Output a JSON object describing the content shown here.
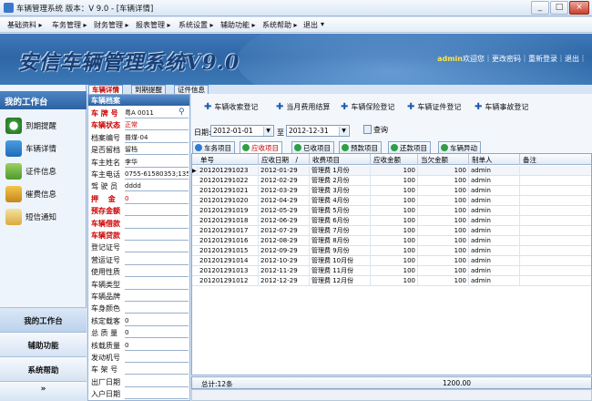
{
  "window": {
    "title": "车辆管理系统  版本：V 9.0 - [车辆详情]",
    "buttons": [
      "_",
      "□",
      "×"
    ]
  },
  "menu": [
    "基础资料 ▸",
    "车务管理 ▸",
    "财务管理 ▸",
    "报表管理 ▸",
    "系统设置 ▸",
    "辅助功能 ▸",
    "系统帮助 ▸",
    "退出",
    "▾"
  ],
  "banner": {
    "title": "安信车辆管理系统V9.0",
    "username": "admin",
    "welcome": "欢迎您",
    "links": "｜更改密码｜重新登录｜退出｜"
  },
  "sidebar": {
    "header": "我的工作台",
    "items": [
      {
        "label": "到期提醒",
        "icon": "clock-icon"
      },
      {
        "label": "车辆详情",
        "icon": "car-icon"
      },
      {
        "label": "证件信息",
        "icon": "certificate-icon"
      },
      {
        "label": "催费信息",
        "icon": "money-icon"
      },
      {
        "label": "短信通知",
        "icon": "envelope-icon"
      }
    ],
    "footer": [
      "我的工作台",
      "辅助功能",
      "系统帮助"
    ]
  },
  "top_tabs": [
    "车辆详情",
    "到期提醒",
    "证件信息"
  ],
  "archive": {
    "header": "车辆档案",
    "fields": [
      {
        "label": "车 牌 号",
        "value": "粤A 0011",
        "red": true
      },
      {
        "label": "车辆状态",
        "value": "正常",
        "red": true,
        "valred": true
      },
      {
        "label": "档案编号",
        "value": "普煤-04"
      },
      {
        "label": "是否留档",
        "value": "留档"
      },
      {
        "label": "车主姓名",
        "value": "李华"
      },
      {
        "label": "车主电话",
        "value": "0755-61580353;135"
      },
      {
        "label": "驾 驶 员",
        "value": "dddd"
      },
      {
        "label": "押　 金",
        "value": "0",
        "red": true,
        "valred": true
      },
      {
        "label": "预存金额",
        "value": "",
        "red": true
      },
      {
        "label": "车辆借款",
        "value": "",
        "red": true
      },
      {
        "label": "车辆贷款",
        "value": "",
        "red": true
      },
      {
        "label": "登记证号",
        "value": ""
      },
      {
        "label": "营运证号",
        "value": ""
      },
      {
        "label": "使用性质",
        "value": ""
      },
      {
        "label": "车辆类型",
        "value": ""
      },
      {
        "label": "车辆品牌",
        "value": ""
      },
      {
        "label": "车身颜色",
        "value": ""
      },
      {
        "label": "核定载客",
        "value": "0"
      },
      {
        "label": "总 质 量",
        "value": "0"
      },
      {
        "label": "核载质量",
        "value": "0"
      },
      {
        "label": "发动机号",
        "value": ""
      },
      {
        "label": "车 架 号",
        "value": ""
      },
      {
        "label": "出厂日期",
        "value": ""
      },
      {
        "label": "入户日期",
        "value": ""
      }
    ]
  },
  "actions": [
    "车辆收索登记",
    "当月费用结算",
    "车辆保险登记",
    "车辆证件登记",
    "车辆事故登记"
  ],
  "filter": {
    "date_label": "日期:",
    "from": "2012-01-01",
    "to_label": "至",
    "to": "2012-12-31",
    "query": "查询"
  },
  "sub_tabs": [
    {
      "label": "车务项目",
      "color": "#2f7bd1"
    },
    {
      "label": "应收项目",
      "color": "#2ea043"
    },
    {
      "label": "已收项目",
      "color": "#2ea043"
    },
    {
      "label": "预款项目",
      "color": "#2ea043"
    },
    {
      "label": "还款项目",
      "color": "#2ea043"
    },
    {
      "label": "车辆异动",
      "color": "#2ea043"
    }
  ],
  "grid": {
    "columns": [
      "单号",
      "应收日期　/",
      "收费项目",
      "应收金额",
      "当欠金额",
      "制单人",
      "备注"
    ],
    "rows": [
      [
        "201201291023",
        "2012-01-29",
        "管理费 1月份",
        "100",
        "100",
        "admin",
        ""
      ],
      [
        "201201291022",
        "2012-02-29",
        "管理费 2月份",
        "100",
        "100",
        "admin",
        ""
      ],
      [
        "201201291021",
        "2012-03-29",
        "管理费 3月份",
        "100",
        "100",
        "admin",
        ""
      ],
      [
        "201201291020",
        "2012-04-29",
        "管理费 4月份",
        "100",
        "100",
        "admin",
        ""
      ],
      [
        "201201291019",
        "2012-05-29",
        "管理费 5月份",
        "100",
        "100",
        "admin",
        ""
      ],
      [
        "201201291018",
        "2012-06-29",
        "管理费 6月份",
        "100",
        "100",
        "admin",
        ""
      ],
      [
        "201201291017",
        "2012-07-29",
        "管理费 7月份",
        "100",
        "100",
        "admin",
        ""
      ],
      [
        "201201291016",
        "2012-08-29",
        "管理费 8月份",
        "100",
        "100",
        "admin",
        ""
      ],
      [
        "201201291015",
        "2012-09-29",
        "管理费 9月份",
        "100",
        "100",
        "admin",
        ""
      ],
      [
        "201201291014",
        "2012-10-29",
        "管理费 10月份",
        "100",
        "100",
        "admin",
        ""
      ],
      [
        "201201291013",
        "2012-11-29",
        "管理费 11月份",
        "100",
        "100",
        "admin",
        ""
      ],
      [
        "201201291012",
        "2012-12-29",
        "管理费 12月份",
        "100",
        "100",
        "admin",
        ""
      ]
    ],
    "footer_count": "总计:12条",
    "footer_total": "1200.00"
  }
}
